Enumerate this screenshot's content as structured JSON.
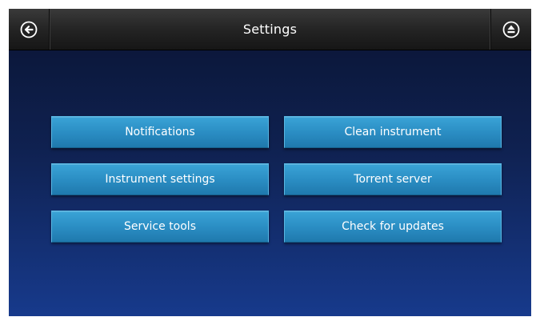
{
  "header": {
    "title": "Settings",
    "back_icon": "back-arrow-circle-icon",
    "eject_icon": "eject-circle-icon"
  },
  "menu": {
    "notifications": "Notifications",
    "clean_instrument": "Clean instrument",
    "instrument_settings": "Instrument settings",
    "torrent_server": "Torrent server",
    "service_tools": "Service tools",
    "check_for_updates": "Check for updates"
  },
  "colors": {
    "background_top": "#0a1433",
    "background_bottom": "#173a8c",
    "button_accent": "#2b8ec4",
    "title_bar": "#242424"
  }
}
